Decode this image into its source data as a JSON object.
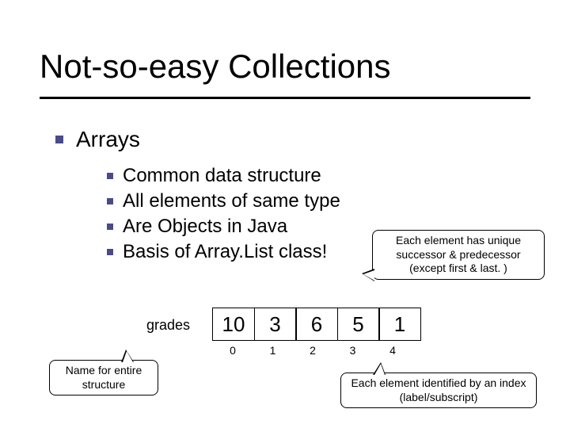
{
  "title": "Not-so-easy Collections",
  "section": "Arrays",
  "bullets": [
    "Common data structure",
    "All elements of same type",
    "Are Objects in Java",
    "Basis of Array.List class!"
  ],
  "callouts": {
    "top": "Each element has unique successor & predecessor (except first & last. )",
    "left": "Name for entire structure",
    "right": "Each element identified by an index (label/subscript)"
  },
  "array": {
    "name": "grades",
    "values": [
      "10",
      "3",
      "6",
      "5",
      "1"
    ],
    "indices": [
      "0",
      "1",
      "2",
      "3",
      "4"
    ]
  }
}
